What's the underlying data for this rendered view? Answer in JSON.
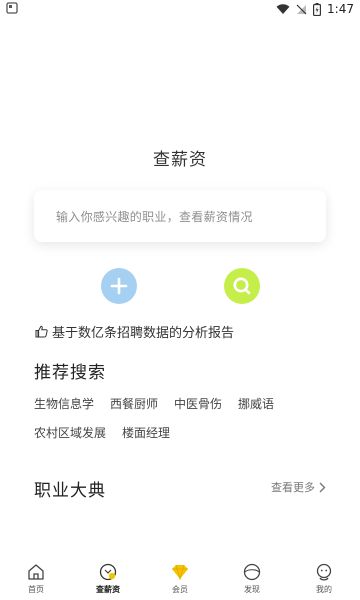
{
  "status_bar": {
    "time": "1:47"
  },
  "page": {
    "title": "查薪资",
    "search_placeholder": "输入你感兴趣的职业，查看薪资情况",
    "stats_text": "基于数亿条招聘数据的分析报告"
  },
  "recommend": {
    "title": "推荐搜索",
    "tags": [
      "生物信息学",
      "西餐厨师",
      "中医骨伤",
      "挪威语",
      "农村区域发展",
      "楼面经理"
    ]
  },
  "career": {
    "title": "职业大典",
    "more": "查看更多"
  },
  "tabbar": {
    "items": [
      {
        "label": "首页",
        "icon": "home-icon"
      },
      {
        "label": "查薪资",
        "icon": "salary-search-icon",
        "active": true
      },
      {
        "label": "会员",
        "icon": "diamond-icon"
      },
      {
        "label": "发现",
        "icon": "discover-icon"
      },
      {
        "label": "我的",
        "icon": "profile-icon"
      }
    ]
  },
  "colors": {
    "add_button": "#a6d0f2",
    "search_button": "#c6ee4b",
    "vip_accent": "#f5c400"
  }
}
